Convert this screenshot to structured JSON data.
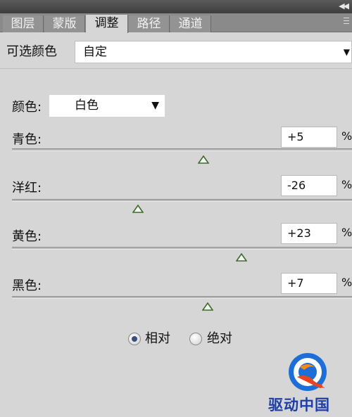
{
  "tabs": [
    {
      "label": "图层",
      "active": false
    },
    {
      "label": "蒙版",
      "active": false
    },
    {
      "label": "调整",
      "active": true
    },
    {
      "label": "路径",
      "active": false
    },
    {
      "label": "通道",
      "active": false
    }
  ],
  "preset": {
    "label": "可选颜色",
    "value": "自定"
  },
  "colors": {
    "label": "颜色:",
    "value": "白色"
  },
  "sliders": [
    {
      "label": "青色:",
      "value": "+5",
      "level": 5,
      "unit": "%"
    },
    {
      "label": "洋红:",
      "value": "-26",
      "level": -26,
      "unit": "%"
    },
    {
      "label": "黄色:",
      "value": "+23",
      "level": 23,
      "unit": "%"
    },
    {
      "label": "黑色:",
      "value": "+7",
      "level": 7,
      "unit": "%"
    }
  ],
  "mode": {
    "relative": "相对",
    "absolute": "绝对",
    "selected": "relative"
  },
  "watermark": {
    "text": "驱动中国"
  },
  "theme": {
    "accent": "#3a4e7a",
    "thumb": "#3f6b2f",
    "brand": "#1d3ea6"
  }
}
